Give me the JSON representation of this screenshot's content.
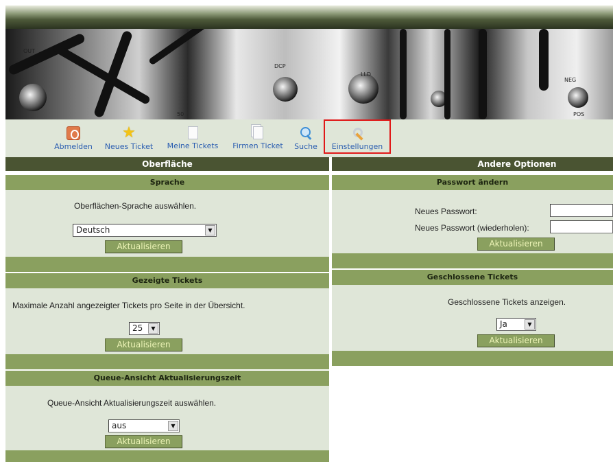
{
  "nav": {
    "items": [
      {
        "label": "Abmelden",
        "icon": "logout-icon"
      },
      {
        "label": "Neues Ticket",
        "icon": "star-icon"
      },
      {
        "label": "Meine Tickets",
        "icon": "document-icon"
      },
      {
        "label": "Firmen Ticket",
        "icon": "documents-icon"
      },
      {
        "label": "Suche",
        "icon": "search-icon"
      },
      {
        "label": "Einstellungen",
        "icon": "wrench-icon"
      }
    ]
  },
  "columns": {
    "left_title": "Oberfläche",
    "right_title": "Andere Optionen"
  },
  "language": {
    "title": "Sprache",
    "description": "Oberflächen-Sprache auswählen.",
    "selected": "Deutsch",
    "button": "Aktualisieren"
  },
  "shown_tickets": {
    "title": "Gezeigte Tickets",
    "description": "Maximale Anzahl angezeigter Tickets pro Seite in der Übersicht.",
    "selected": "25",
    "button": "Aktualisieren"
  },
  "queue_refresh": {
    "title": "Queue-Ansicht Aktualisierungszeit",
    "description": "Queue-Ansicht Aktualisierungszeit auswählen.",
    "selected": "aus",
    "button": "Aktualisieren"
  },
  "password": {
    "title": "Passwort ändern",
    "new_label": "Neues Passwort:",
    "repeat_label": "Neues Passwort (wiederholen):",
    "new_value": "",
    "repeat_value": "",
    "button": "Aktualisieren"
  },
  "closed_tickets": {
    "title": "Geschlossene Tickets",
    "description": "Geschlossene Tickets anzeigen.",
    "selected": "Ja",
    "button": "Aktualisieren"
  },
  "colors": {
    "dark_header": "#4a5432",
    "panel_title": "#8aa05f",
    "panel_body": "#dfe6d8",
    "link": "#2a5db0",
    "button_text": "#eef5b8",
    "highlight": "#e01818"
  },
  "banner_labels": [
    "OUT",
    "DCP",
    "LLD",
    "NEG",
    "POS",
    "50"
  ]
}
